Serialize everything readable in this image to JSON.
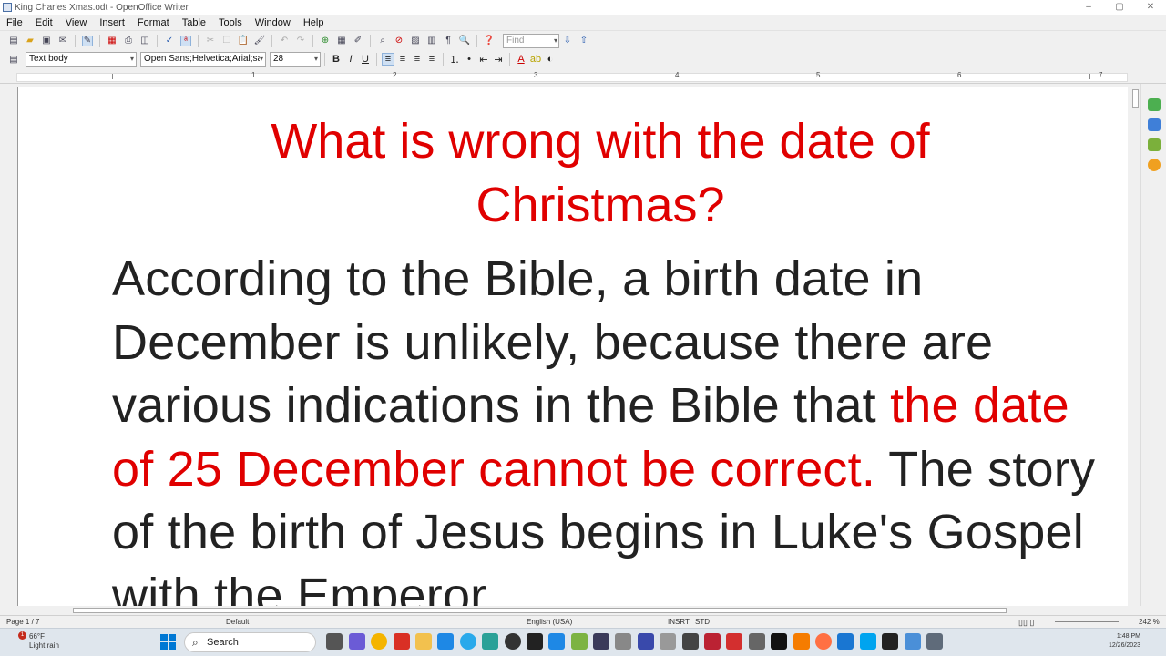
{
  "window": {
    "title": "King Charles Xmas.odt - OpenOffice Writer",
    "controls": [
      "–",
      "▢",
      "✕"
    ]
  },
  "menu": [
    "File",
    "Edit",
    "View",
    "Insert",
    "Format",
    "Table",
    "Tools",
    "Window",
    "Help"
  ],
  "toolbar": {
    "find_placeholder": "Find"
  },
  "formatting": {
    "paragraph_style": "Text body",
    "font_name": "Open Sans;Helvetica;Arial;sa",
    "font_size": "28",
    "bold": "B",
    "italic": "I",
    "underline": "U"
  },
  "ruler": {
    "numbers": [
      "1",
      "2",
      "3",
      "4",
      "5",
      "6",
      "7"
    ]
  },
  "document": {
    "title_line1": "What is wrong with the date of",
    "title_line2": "Christmas?",
    "para_part1": "According to the Bible, a birth date in December is unlikely, because there are various indications in the Bible that ",
    "para_highlight": "the date of 25 December cannot be correct.",
    "para_part2": " The story of the birth of Jesus begins in Luke's Gospel with the Emperor"
  },
  "status": {
    "page": "Page 1 / 7",
    "page_style": "Default",
    "language": "English (USA)",
    "insert_mode": "INSRT",
    "selection_mode": "STD",
    "zoom": "242 %"
  },
  "taskbar": {
    "weather_temp": "66°F",
    "weather_desc": "Light rain",
    "notification_count": "1",
    "search_label": "Search",
    "time": "1:48 PM",
    "date": "12/26/2023"
  },
  "colors": {
    "heading_red": "#e00000",
    "body_text": "#222222",
    "windows_blue": "#0078d4"
  }
}
